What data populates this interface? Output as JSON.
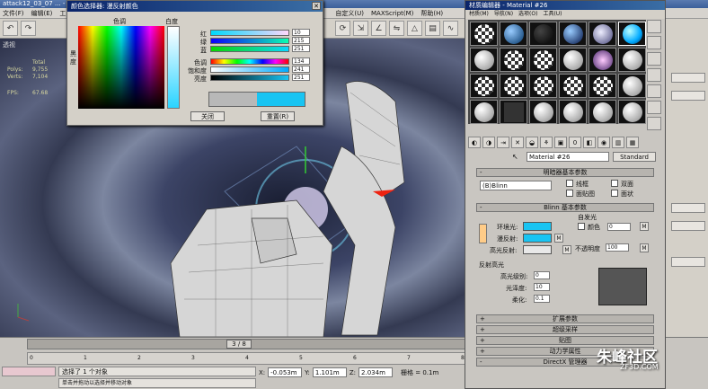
{
  "window": {
    "title": "attack12_03_07 ... - 显示 : Direct 3D"
  },
  "menu": [
    "文件(F)",
    "编辑(E)",
    "工",
    "自定义(U)",
    "MAXScript(M)",
    "帮助(H)"
  ],
  "viewport": {
    "label": "透视",
    "stats": [
      {
        "k": "",
        "v": "Total"
      },
      {
        "k": "Polys:",
        "v": "9,755"
      },
      {
        "k": "Verts:",
        "v": "7,104"
      },
      {
        "k": "FPS:",
        "v": "67.68"
      }
    ]
  },
  "color_dialog": {
    "title": "颜色选择器: 漫反射颜色",
    "hue_label": "色调",
    "white_label": "白度",
    "black_label": "黑度",
    "sliders": [
      {
        "label": "红",
        "value": "10"
      },
      {
        "label": "绿",
        "value": "215"
      },
      {
        "label": "蓝",
        "value": "251"
      },
      {
        "label": "色调",
        "value": "134"
      },
      {
        "label": "饱和度",
        "value": "241"
      },
      {
        "label": "亮度",
        "value": "251"
      }
    ],
    "close_button": "关闭",
    "reset_button": "重置(R)",
    "old_color": "#b8b8b8",
    "new_color": "#19c4f2"
  },
  "material_editor": {
    "title": "材质编辑器 - Material #26",
    "menu": [
      "材质(M)",
      "导航(N)",
      "选项(O)",
      "工具(U)"
    ],
    "material_name": "Material #26",
    "type_button": "Standard",
    "rollouts": {
      "shader_basic": "明暗器基本参数",
      "blinn_basic": "Blinn 基本参数",
      "extended": "扩展参数",
      "supersampling": "超级采样",
      "maps": "贴图",
      "dynamics": "动力学属性",
      "directx": "DirectX 管理器"
    },
    "shader": "(B)Blinn",
    "shader_options": [
      "线框",
      "双面",
      "面贴图",
      "面状"
    ],
    "self_illum": "自发光",
    "color_label": "颜色",
    "color_value": "0",
    "ambient": "环境光:",
    "diffuse": "漫反射:",
    "specular": "高光反射:",
    "opacity_label": "不透明度",
    "opacity_value": "100",
    "specular_highlights": "反射高光",
    "spec_level_label": "高光级别:",
    "spec_level": "0",
    "glossiness_label": "光泽度:",
    "glossiness": "10",
    "soften_label": "柔化:",
    "soften": "0.1",
    "m_label": "M"
  },
  "timeline": {
    "frame": "3 / 8",
    "ruler_ticks": [
      "0",
      "1",
      "2",
      "3",
      "4",
      "5",
      "6",
      "7",
      "8"
    ]
  },
  "status": {
    "selection": "选择了 1 个对象",
    "prompt": "单击并拖动以选择并移动对象",
    "x_label": "X:",
    "x": "-0.053m",
    "y_label": "Y:",
    "y": "1.101m",
    "z_label": "Z:",
    "z": "2.034m",
    "grid": "栅格 = 0.1m"
  },
  "watermark": {
    "main": "朱峰社区",
    "sub": "ZF3D.COM"
  }
}
